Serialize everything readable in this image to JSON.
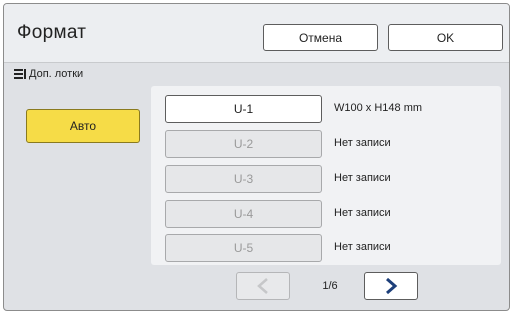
{
  "header": {
    "title": "Формат",
    "cancel_label": "Отмена",
    "ok_label": "OK"
  },
  "section": {
    "label": "Доп. лотки",
    "icon": "list-icon"
  },
  "auto_button": {
    "label": "Авто",
    "color": "#f6dc47"
  },
  "trays": [
    {
      "label": "U-1",
      "desc": "W100 x H148 mm",
      "enabled": true
    },
    {
      "label": "U-2",
      "desc": "Нет записи",
      "enabled": false
    },
    {
      "label": "U-3",
      "desc": "Нет записи",
      "enabled": false
    },
    {
      "label": "U-4",
      "desc": "Нет записи",
      "enabled": false
    },
    {
      "label": "U-5",
      "desc": "Нет записи",
      "enabled": false
    }
  ],
  "pager": {
    "page_text": "1/6",
    "prev_icon": "chevron-left-icon",
    "next_icon": "chevron-right-icon",
    "prev_enabled": false,
    "next_enabled": true
  }
}
